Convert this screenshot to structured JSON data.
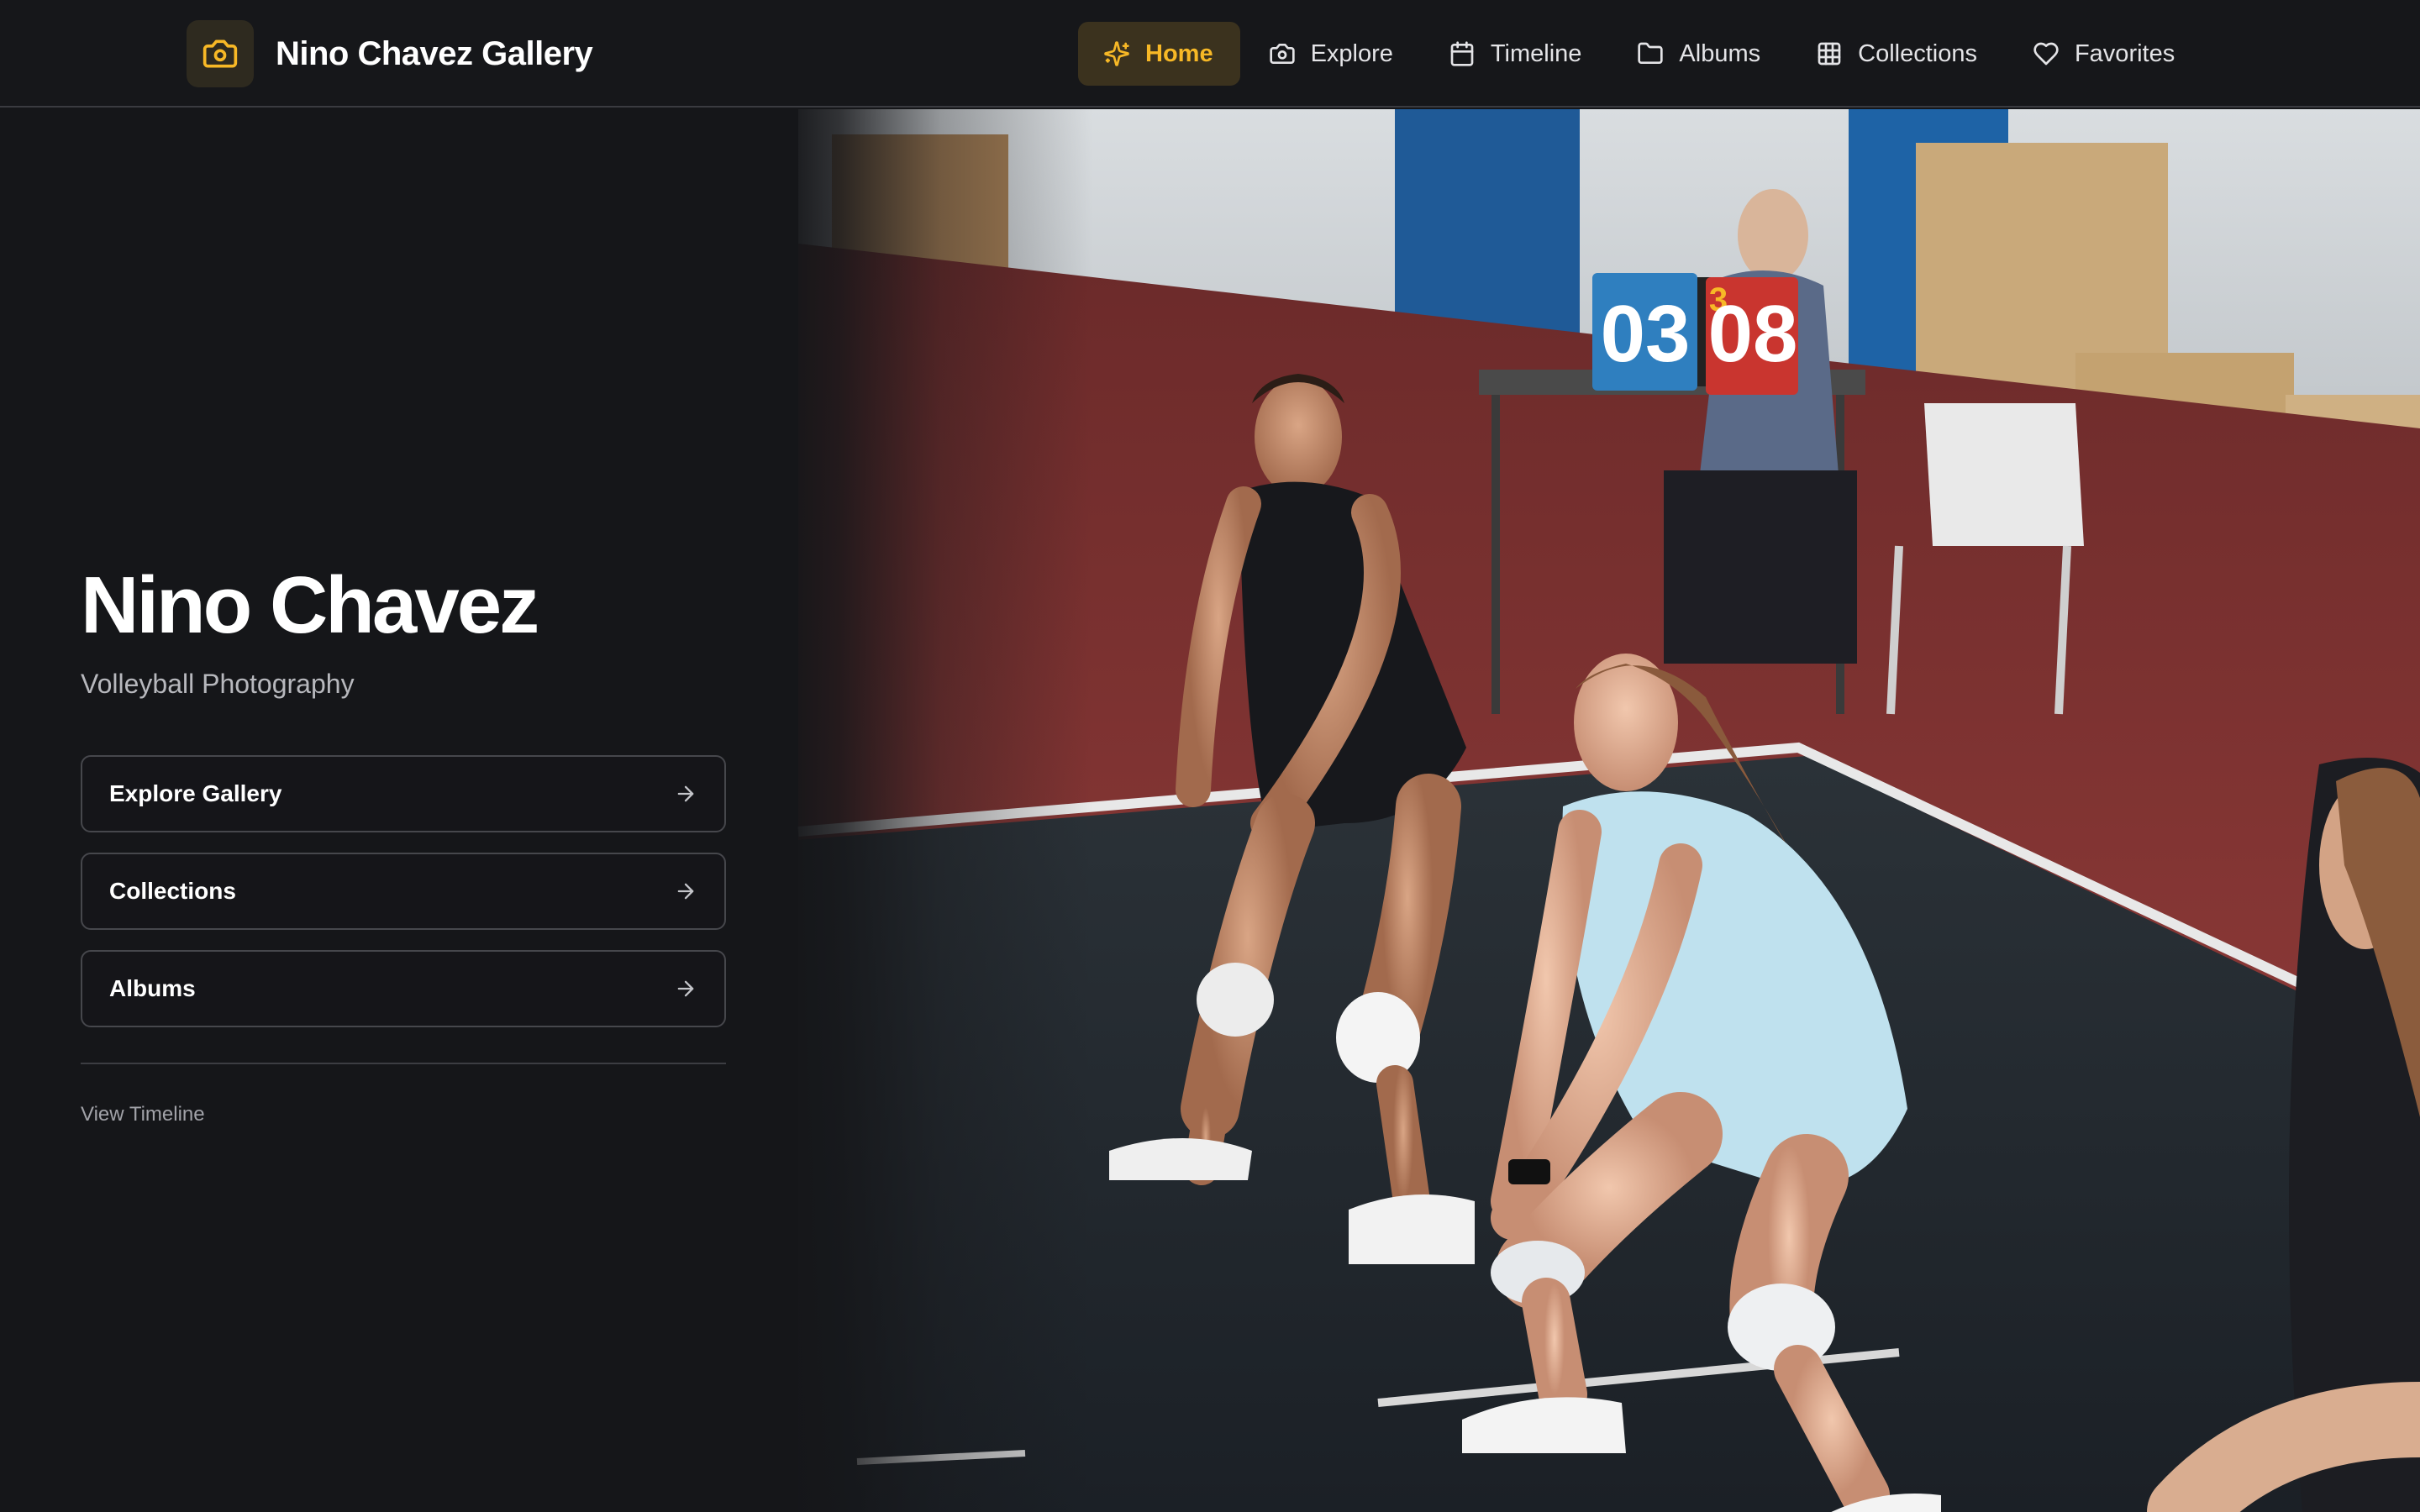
{
  "header": {
    "brand_title": "Nino Chavez Gallery",
    "brand_icon": "camera-icon",
    "accent_color": "#f7b826",
    "nav": [
      {
        "label": "Home",
        "icon": "sparkles-icon",
        "active": true
      },
      {
        "label": "Explore",
        "icon": "camera-icon",
        "active": false
      },
      {
        "label": "Timeline",
        "icon": "calendar-icon",
        "active": false
      },
      {
        "label": "Albums",
        "icon": "folder-icon",
        "active": false
      },
      {
        "label": "Collections",
        "icon": "grid-icon",
        "active": false
      },
      {
        "label": "Favorites",
        "icon": "heart-icon",
        "active": false
      }
    ]
  },
  "hero": {
    "name": "Nino Chavez",
    "subtitle": "Volleyball Photography",
    "image_subject": "two volleyball players in a defensive ready stance on an indoor court",
    "scoreboard": {
      "left": "03",
      "middle": "3",
      "right": "08"
    },
    "actions": [
      {
        "label": "Explore Gallery",
        "icon": "arrow-right-icon"
      },
      {
        "label": "Collections",
        "icon": "arrow-right-icon"
      },
      {
        "label": "Albums",
        "icon": "arrow-right-icon"
      }
    ],
    "timeline_link": "View Timeline"
  }
}
